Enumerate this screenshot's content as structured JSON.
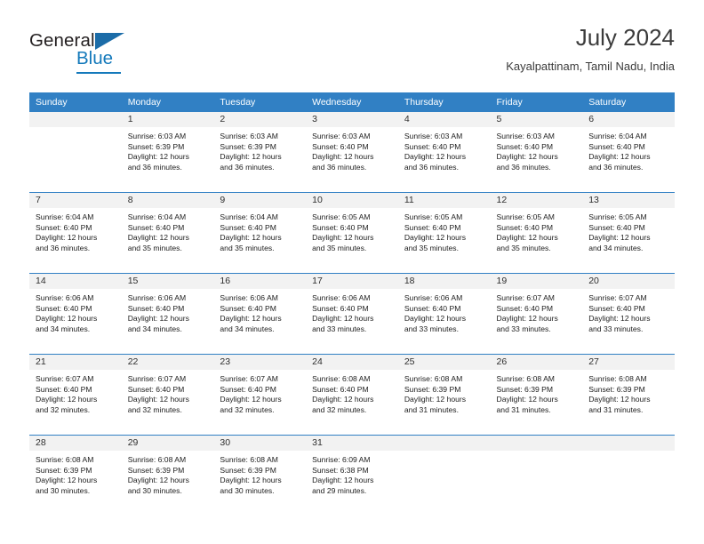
{
  "brand": {
    "word_general": "General",
    "word_blue": "Blue",
    "triangle_color": "#1b6ca8",
    "blue_color": "#1479bb"
  },
  "header": {
    "title": "July 2024",
    "subtitle": "Kayalpattinam, Tamil Nadu, India"
  },
  "theme": {
    "header_bg": "#3180c4",
    "daynum_bg": "#f2f2f2",
    "rule_color": "#3180c4"
  },
  "weekdays": [
    "Sunday",
    "Monday",
    "Tuesday",
    "Wednesday",
    "Thursday",
    "Friday",
    "Saturday"
  ],
  "weeks": [
    [
      {
        "day": "",
        "sunrise": "",
        "sunset": "",
        "daylight1": "",
        "daylight2": ""
      },
      {
        "day": "1",
        "sunrise": "Sunrise: 6:03 AM",
        "sunset": "Sunset: 6:39 PM",
        "daylight1": "Daylight: 12 hours",
        "daylight2": "and 36 minutes."
      },
      {
        "day": "2",
        "sunrise": "Sunrise: 6:03 AM",
        "sunset": "Sunset: 6:39 PM",
        "daylight1": "Daylight: 12 hours",
        "daylight2": "and 36 minutes."
      },
      {
        "day": "3",
        "sunrise": "Sunrise: 6:03 AM",
        "sunset": "Sunset: 6:40 PM",
        "daylight1": "Daylight: 12 hours",
        "daylight2": "and 36 minutes."
      },
      {
        "day": "4",
        "sunrise": "Sunrise: 6:03 AM",
        "sunset": "Sunset: 6:40 PM",
        "daylight1": "Daylight: 12 hours",
        "daylight2": "and 36 minutes."
      },
      {
        "day": "5",
        "sunrise": "Sunrise: 6:03 AM",
        "sunset": "Sunset: 6:40 PM",
        "daylight1": "Daylight: 12 hours",
        "daylight2": "and 36 minutes."
      },
      {
        "day": "6",
        "sunrise": "Sunrise: 6:04 AM",
        "sunset": "Sunset: 6:40 PM",
        "daylight1": "Daylight: 12 hours",
        "daylight2": "and 36 minutes."
      }
    ],
    [
      {
        "day": "7",
        "sunrise": "Sunrise: 6:04 AM",
        "sunset": "Sunset: 6:40 PM",
        "daylight1": "Daylight: 12 hours",
        "daylight2": "and 36 minutes."
      },
      {
        "day": "8",
        "sunrise": "Sunrise: 6:04 AM",
        "sunset": "Sunset: 6:40 PM",
        "daylight1": "Daylight: 12 hours",
        "daylight2": "and 35 minutes."
      },
      {
        "day": "9",
        "sunrise": "Sunrise: 6:04 AM",
        "sunset": "Sunset: 6:40 PM",
        "daylight1": "Daylight: 12 hours",
        "daylight2": "and 35 minutes."
      },
      {
        "day": "10",
        "sunrise": "Sunrise: 6:05 AM",
        "sunset": "Sunset: 6:40 PM",
        "daylight1": "Daylight: 12 hours",
        "daylight2": "and 35 minutes."
      },
      {
        "day": "11",
        "sunrise": "Sunrise: 6:05 AM",
        "sunset": "Sunset: 6:40 PM",
        "daylight1": "Daylight: 12 hours",
        "daylight2": "and 35 minutes."
      },
      {
        "day": "12",
        "sunrise": "Sunrise: 6:05 AM",
        "sunset": "Sunset: 6:40 PM",
        "daylight1": "Daylight: 12 hours",
        "daylight2": "and 35 minutes."
      },
      {
        "day": "13",
        "sunrise": "Sunrise: 6:05 AM",
        "sunset": "Sunset: 6:40 PM",
        "daylight1": "Daylight: 12 hours",
        "daylight2": "and 34 minutes."
      }
    ],
    [
      {
        "day": "14",
        "sunrise": "Sunrise: 6:06 AM",
        "sunset": "Sunset: 6:40 PM",
        "daylight1": "Daylight: 12 hours",
        "daylight2": "and 34 minutes."
      },
      {
        "day": "15",
        "sunrise": "Sunrise: 6:06 AM",
        "sunset": "Sunset: 6:40 PM",
        "daylight1": "Daylight: 12 hours",
        "daylight2": "and 34 minutes."
      },
      {
        "day": "16",
        "sunrise": "Sunrise: 6:06 AM",
        "sunset": "Sunset: 6:40 PM",
        "daylight1": "Daylight: 12 hours",
        "daylight2": "and 34 minutes."
      },
      {
        "day": "17",
        "sunrise": "Sunrise: 6:06 AM",
        "sunset": "Sunset: 6:40 PM",
        "daylight1": "Daylight: 12 hours",
        "daylight2": "and 33 minutes."
      },
      {
        "day": "18",
        "sunrise": "Sunrise: 6:06 AM",
        "sunset": "Sunset: 6:40 PM",
        "daylight1": "Daylight: 12 hours",
        "daylight2": "and 33 minutes."
      },
      {
        "day": "19",
        "sunrise": "Sunrise: 6:07 AM",
        "sunset": "Sunset: 6:40 PM",
        "daylight1": "Daylight: 12 hours",
        "daylight2": "and 33 minutes."
      },
      {
        "day": "20",
        "sunrise": "Sunrise: 6:07 AM",
        "sunset": "Sunset: 6:40 PM",
        "daylight1": "Daylight: 12 hours",
        "daylight2": "and 33 minutes."
      }
    ],
    [
      {
        "day": "21",
        "sunrise": "Sunrise: 6:07 AM",
        "sunset": "Sunset: 6:40 PM",
        "daylight1": "Daylight: 12 hours",
        "daylight2": "and 32 minutes."
      },
      {
        "day": "22",
        "sunrise": "Sunrise: 6:07 AM",
        "sunset": "Sunset: 6:40 PM",
        "daylight1": "Daylight: 12 hours",
        "daylight2": "and 32 minutes."
      },
      {
        "day": "23",
        "sunrise": "Sunrise: 6:07 AM",
        "sunset": "Sunset: 6:40 PM",
        "daylight1": "Daylight: 12 hours",
        "daylight2": "and 32 minutes."
      },
      {
        "day": "24",
        "sunrise": "Sunrise: 6:08 AM",
        "sunset": "Sunset: 6:40 PM",
        "daylight1": "Daylight: 12 hours",
        "daylight2": "and 32 minutes."
      },
      {
        "day": "25",
        "sunrise": "Sunrise: 6:08 AM",
        "sunset": "Sunset: 6:39 PM",
        "daylight1": "Daylight: 12 hours",
        "daylight2": "and 31 minutes."
      },
      {
        "day": "26",
        "sunrise": "Sunrise: 6:08 AM",
        "sunset": "Sunset: 6:39 PM",
        "daylight1": "Daylight: 12 hours",
        "daylight2": "and 31 minutes."
      },
      {
        "day": "27",
        "sunrise": "Sunrise: 6:08 AM",
        "sunset": "Sunset: 6:39 PM",
        "daylight1": "Daylight: 12 hours",
        "daylight2": "and 31 minutes."
      }
    ],
    [
      {
        "day": "28",
        "sunrise": "Sunrise: 6:08 AM",
        "sunset": "Sunset: 6:39 PM",
        "daylight1": "Daylight: 12 hours",
        "daylight2": "and 30 minutes."
      },
      {
        "day": "29",
        "sunrise": "Sunrise: 6:08 AM",
        "sunset": "Sunset: 6:39 PM",
        "daylight1": "Daylight: 12 hours",
        "daylight2": "and 30 minutes."
      },
      {
        "day": "30",
        "sunrise": "Sunrise: 6:08 AM",
        "sunset": "Sunset: 6:39 PM",
        "daylight1": "Daylight: 12 hours",
        "daylight2": "and 30 minutes."
      },
      {
        "day": "31",
        "sunrise": "Sunrise: 6:09 AM",
        "sunset": "Sunset: 6:38 PM",
        "daylight1": "Daylight: 12 hours",
        "daylight2": "and 29 minutes."
      },
      {
        "day": "",
        "sunrise": "",
        "sunset": "",
        "daylight1": "",
        "daylight2": ""
      },
      {
        "day": "",
        "sunrise": "",
        "sunset": "",
        "daylight1": "",
        "daylight2": ""
      },
      {
        "day": "",
        "sunrise": "",
        "sunset": "",
        "daylight1": "",
        "daylight2": ""
      }
    ]
  ]
}
